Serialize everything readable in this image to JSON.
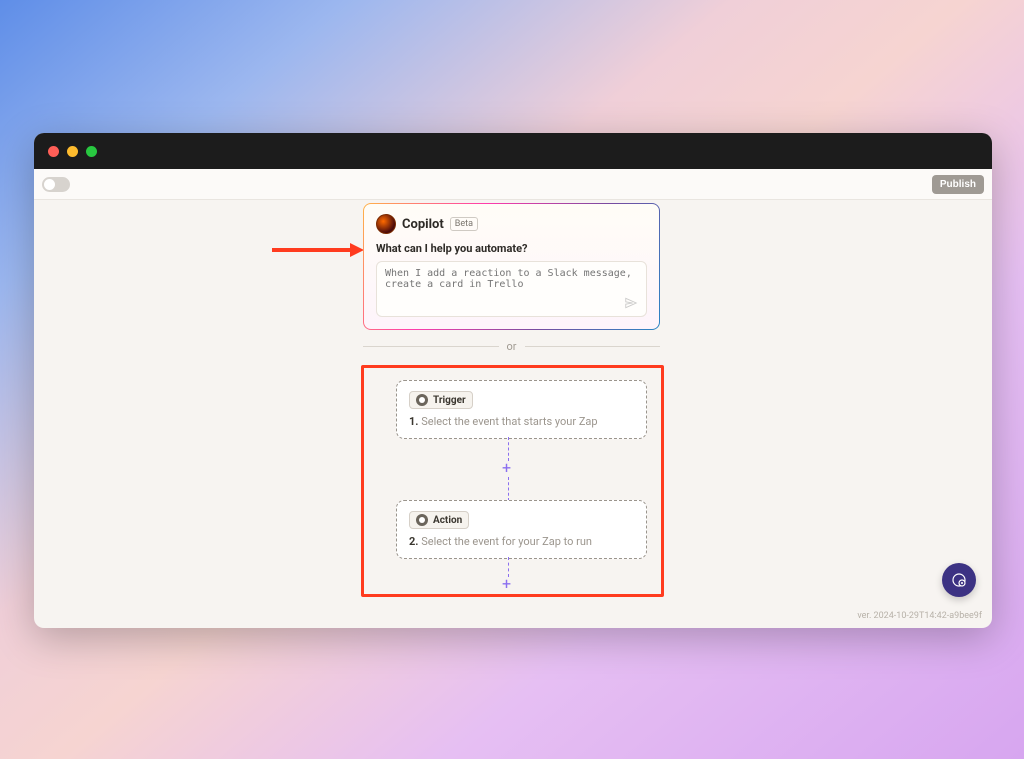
{
  "toolbar": {
    "publish_label": "Publish"
  },
  "copilot": {
    "title": "Copilot",
    "badge": "Beta",
    "prompt": "What can I help you automate?",
    "placeholder": "When I add a reaction to a Slack message, create a card in Trello"
  },
  "divider": {
    "or": "or"
  },
  "steps": {
    "trigger": {
      "badge": "Trigger",
      "num": "1.",
      "text": "Select the event that starts your Zap"
    },
    "action": {
      "badge": "Action",
      "num": "2.",
      "text": "Select the event for your Zap to run"
    }
  },
  "footer": {
    "version": "ver. 2024-10-29T14:42-a9bee9f"
  }
}
